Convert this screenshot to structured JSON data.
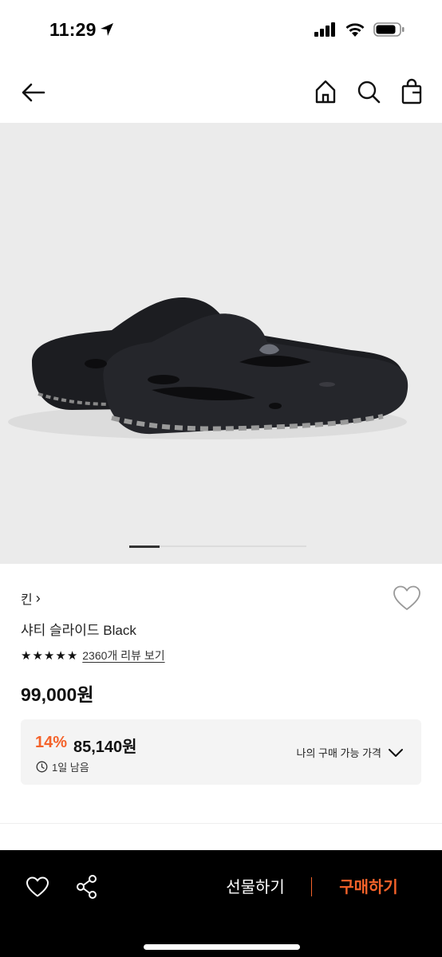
{
  "status_bar": {
    "time": "11:29"
  },
  "product": {
    "brand": "킨",
    "brand_chevron": "›",
    "name": "샤티 슬라이드 Black",
    "rating_stars": 5,
    "review_text": "2360개 리뷰 보기",
    "price": "99,000원",
    "image_count_indicator": "1"
  },
  "coupon": {
    "discount_rate": "14%",
    "discounted_price": "85,140원",
    "time_left": "1일 남음",
    "my_price_label": "나의 구매 가능 가격"
  },
  "bottom_bar": {
    "gift_label": "선물하기",
    "buy_label": "구매하기"
  },
  "colors": {
    "accent": "#f4622a",
    "image_bg": "#ebebeb",
    "bottom_bar_bg": "#000000"
  }
}
